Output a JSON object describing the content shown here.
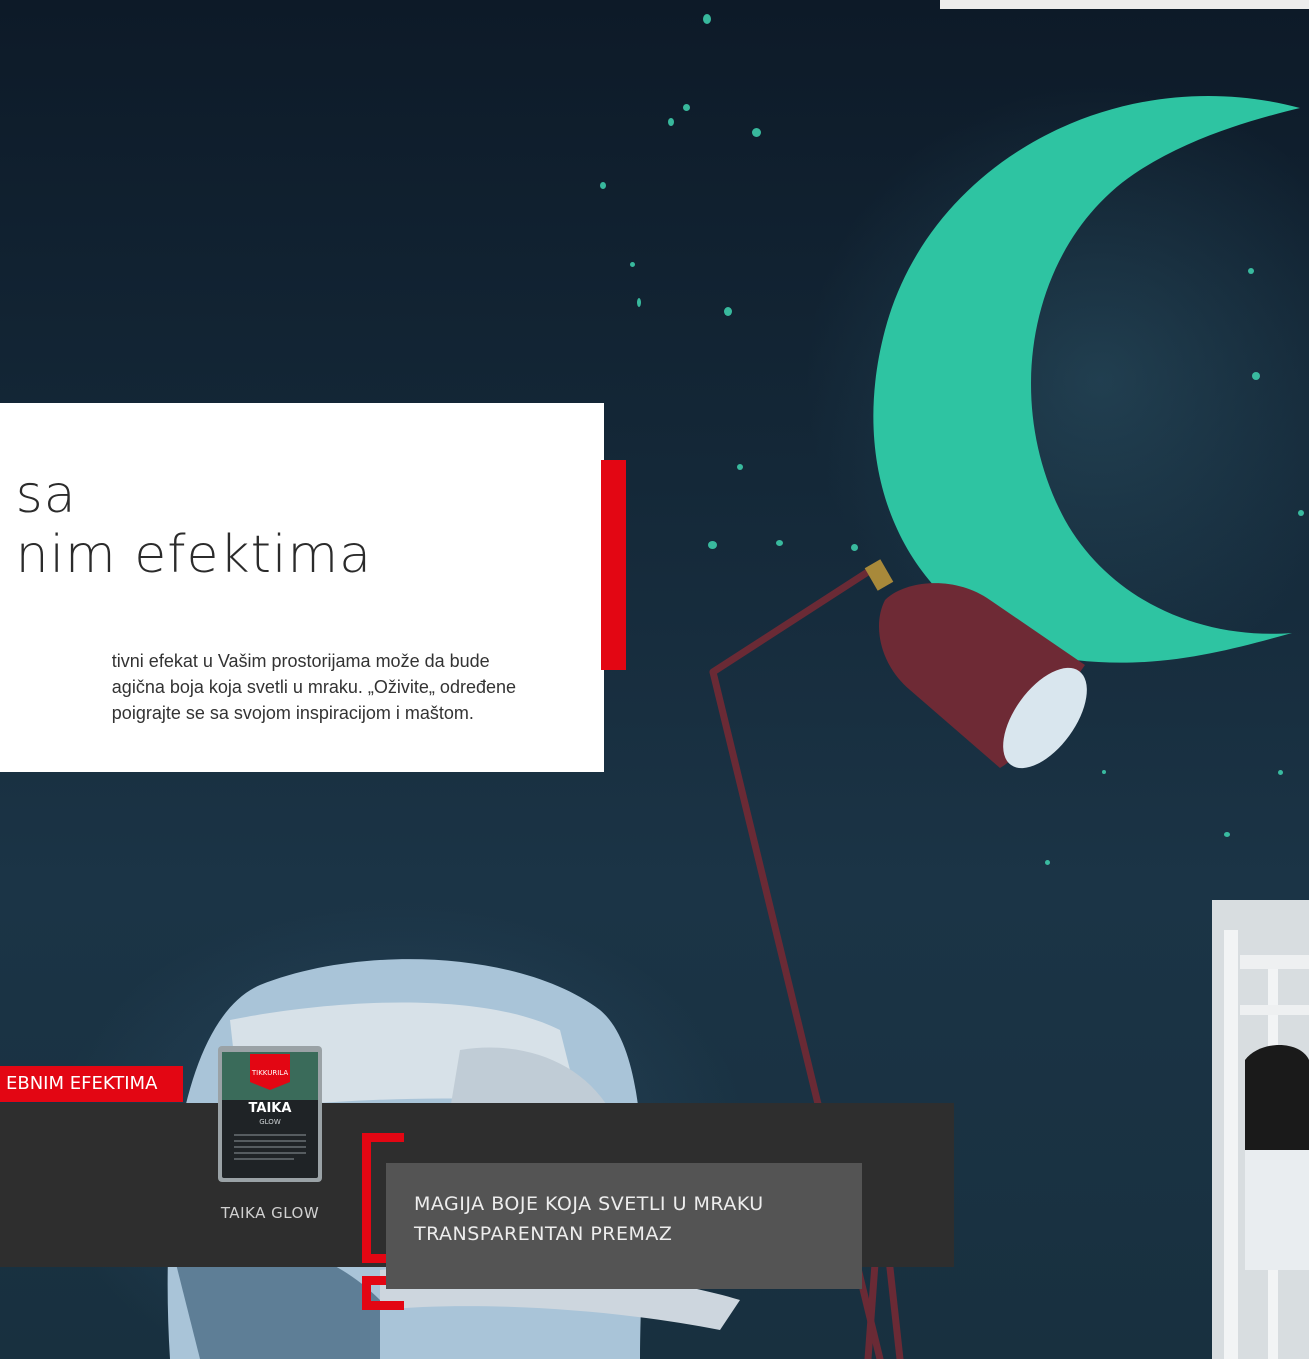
{
  "hero": {
    "headline_line1": "sa",
    "headline_line2": "nim efektima",
    "body_line1": "tivni efekat u Vašim prostorijama može da bude",
    "body_line2": "agična boja koja svetli u mraku. „Oživite„ određene",
    "body_line3": "poigrajte se sa svojom inspiracijom i maštom."
  },
  "category": {
    "label": "EBNIM EFEKTIMA"
  },
  "product": {
    "name": "TAIKA GLOW",
    "can_brand": "TIKKURILA",
    "can_title": "TAIKA",
    "can_subtitle": "GLOW"
  },
  "description": {
    "line1": "MAGIJA BOJE KOJA SVETLI U MRAKU",
    "line2": "TRANSPARENTAN PREMAZ"
  },
  "colors": {
    "accent_red": "#e30613",
    "moon_green": "#2ec4a2",
    "dark_bar": "#2e2e2e",
    "desc_box": "#545454"
  },
  "icons": [
    "moon-glow-shape",
    "floor-lamp",
    "paint-can",
    "bracket-accent"
  ]
}
